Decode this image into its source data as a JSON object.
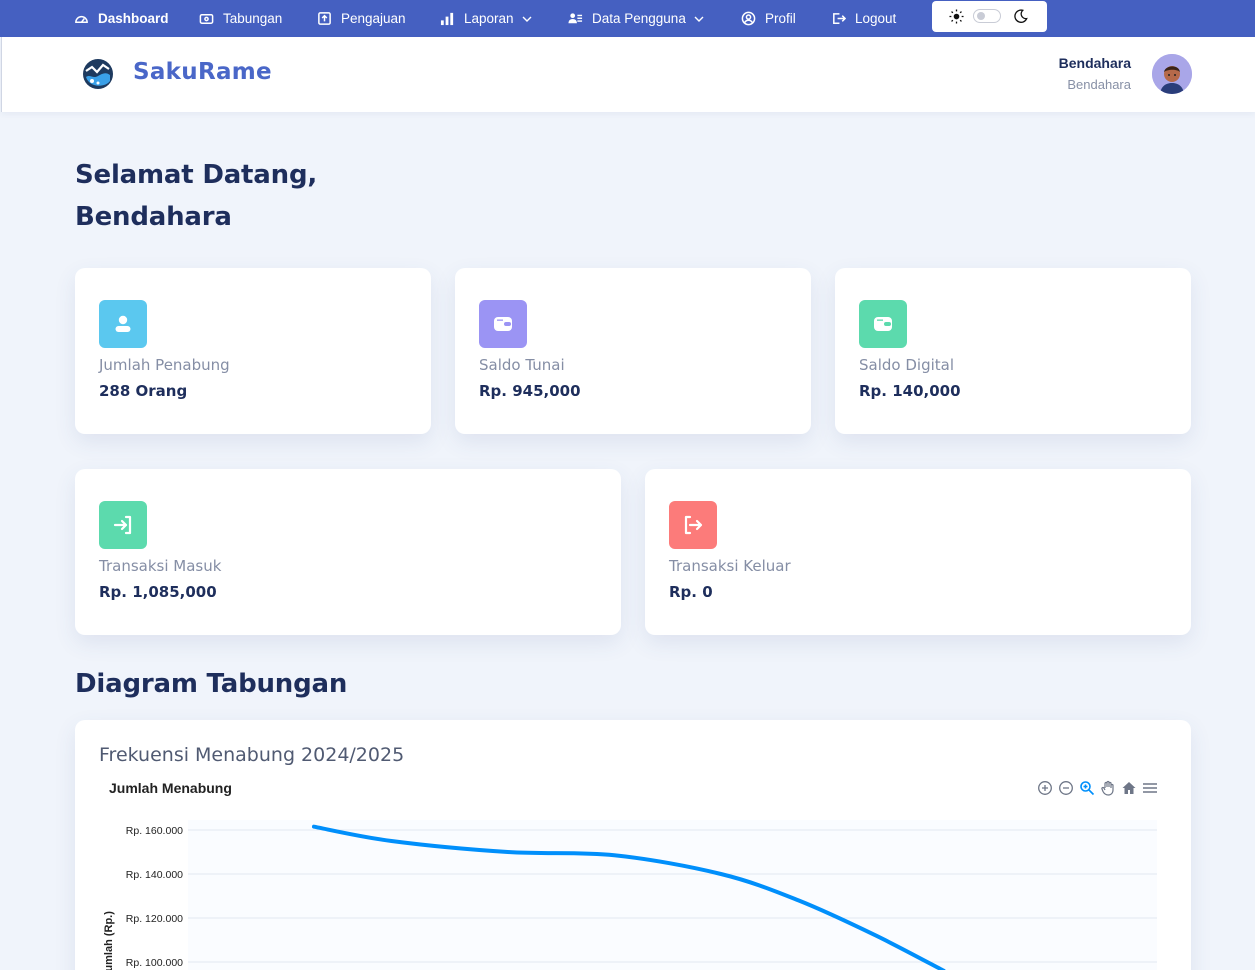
{
  "nav": {
    "items": [
      {
        "label": "Dashboard",
        "icon": "dashboard-icon"
      },
      {
        "label": "Tabungan",
        "icon": "wallet-icon"
      },
      {
        "label": "Pengajuan",
        "icon": "upload-icon"
      },
      {
        "label": "Laporan",
        "icon": "bar-chart-icon"
      },
      {
        "label": "Data Pengguna",
        "icon": "users-icon"
      },
      {
        "label": "Profil",
        "icon": "user-circle-icon"
      },
      {
        "label": "Logout",
        "icon": "logout-icon"
      }
    ]
  },
  "header": {
    "brand": "SakuRame",
    "user_name": "Bendahara",
    "user_role": "Bendahara"
  },
  "welcome": {
    "line1": "Selamat Datang,",
    "line2": "Bendahara"
  },
  "cards": [
    {
      "label": "Jumlah Penabung",
      "value": "288 Orang",
      "color": "#5bc8ef",
      "icon": "user-icon"
    },
    {
      "label": "Saldo Tunai",
      "value": "Rp. 945,000",
      "color": "#9b94f4",
      "icon": "wallet-icon"
    },
    {
      "label": "Saldo Digital",
      "value": "Rp. 140,000",
      "color": "#5cdaad",
      "icon": "wallet-icon"
    },
    {
      "label": "Transaksi Masuk",
      "value": "Rp. 1,085,000",
      "color": "#5cdaad",
      "icon": "login-icon"
    },
    {
      "label": "Transaksi Keluar",
      "value": "Rp. 0",
      "color": "#fc7b7a",
      "icon": "logout-icon"
    }
  ],
  "section_title": "Diagram Tabungan",
  "chart_card": {
    "heading": "Frekuensi Menabung 2024/2025"
  },
  "chart_data": {
    "type": "line",
    "title": "Jumlah Menabung",
    "ylabel": "Jumlah (Rp.)",
    "ytick_labels": [
      "Rp. 160.000",
      "Rp. 140.000",
      "Rp. 120.000",
      "Rp. 100.000"
    ],
    "ylim": [
      90000,
      165000
    ],
    "series": [
      {
        "color": "#008ffb",
        "points": [
          [
            0.13,
            161500
          ],
          [
            0.21,
            155000
          ],
          [
            0.33,
            150000
          ],
          [
            0.44,
            148500
          ],
          [
            0.55,
            140000
          ],
          [
            0.63,
            128000
          ],
          [
            0.71,
            112000
          ],
          [
            0.78,
            96000
          ]
        ]
      }
    ],
    "grid": true
  }
}
